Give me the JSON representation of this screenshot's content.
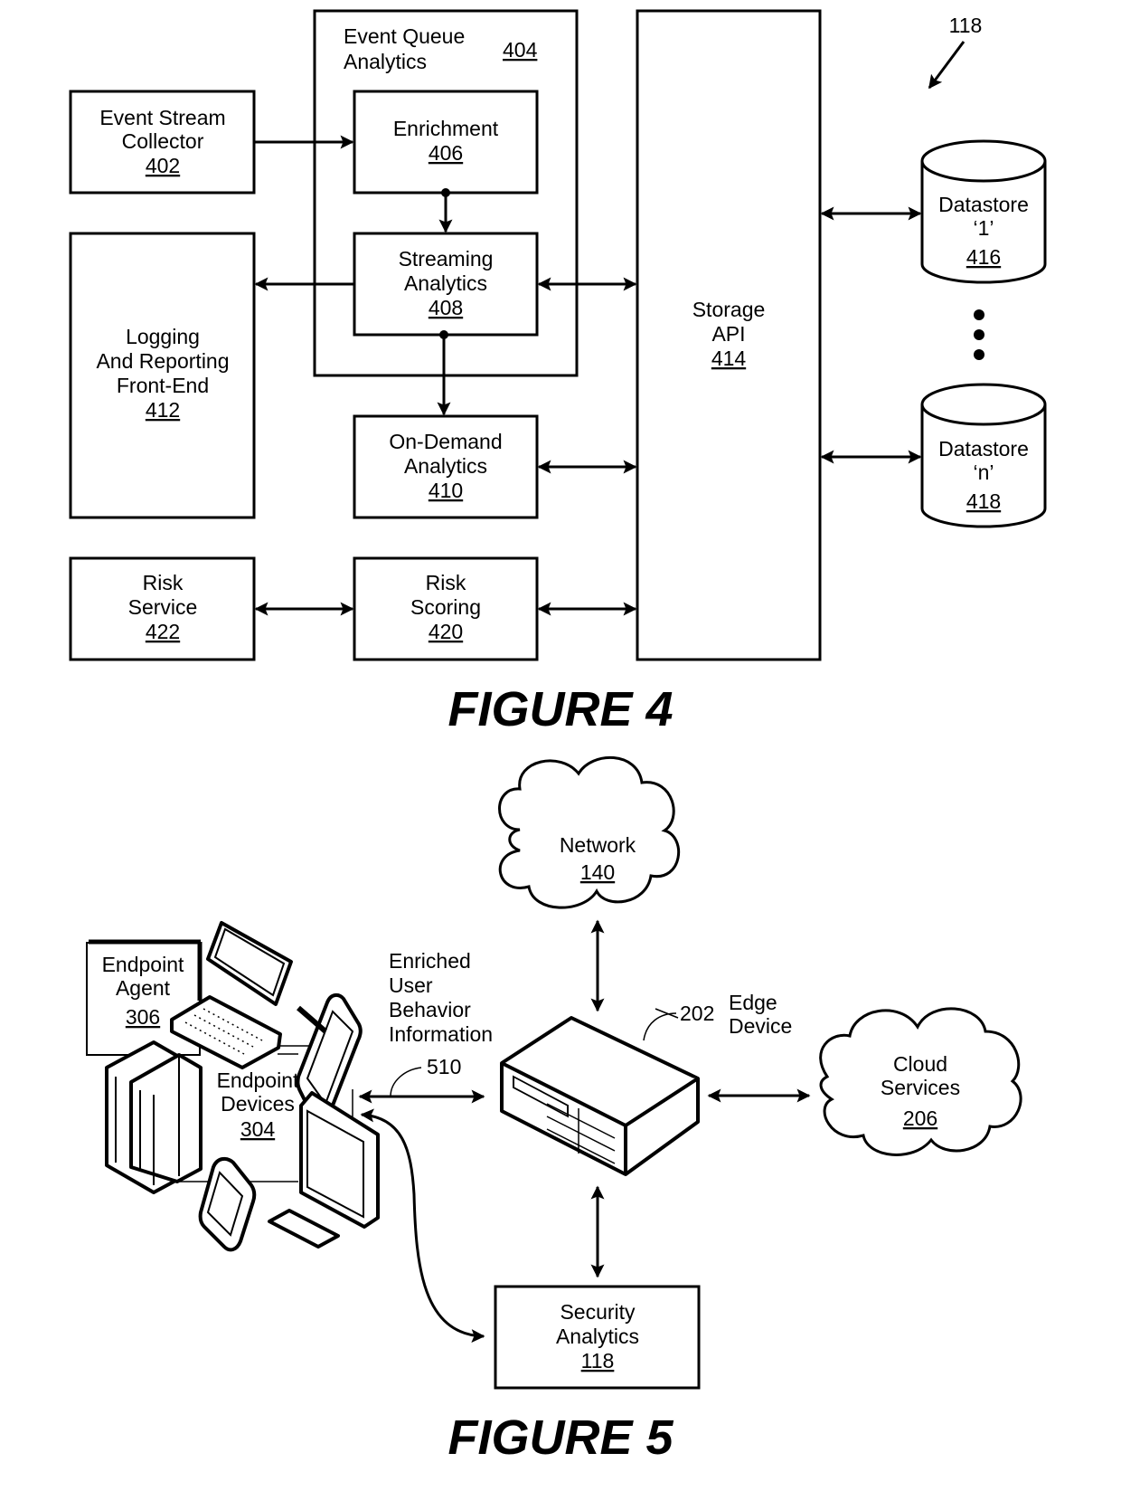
{
  "figure4": {
    "caption": "FIGURE 4",
    "reference_label": "118",
    "nodes": {
      "event_stream_collector": {
        "lines": [
          "Event Stream",
          "Collector"
        ],
        "ref": "402"
      },
      "event_queue_analytics": {
        "lines": [
          "Event Queue",
          "Analytics"
        ],
        "ref": "404"
      },
      "enrichment": {
        "lines": [
          "Enrichment"
        ],
        "ref": "406"
      },
      "streaming_analytics": {
        "lines": [
          "Streaming",
          "Analytics"
        ],
        "ref": "408"
      },
      "on_demand_analytics": {
        "lines": [
          "On-Demand",
          "Analytics"
        ],
        "ref": "410"
      },
      "logging_reporting": {
        "lines": [
          "Logging",
          "And Reporting",
          "Front-End"
        ],
        "ref": "412"
      },
      "storage_api": {
        "lines": [
          "Storage",
          "API"
        ],
        "ref": "414"
      },
      "datastore_1": {
        "lines": [
          "Datastore",
          "‘1’"
        ],
        "ref": "416"
      },
      "datastore_n": {
        "lines": [
          "Datastore",
          "‘n’"
        ],
        "ref": "418"
      },
      "risk_scoring": {
        "lines": [
          "Risk",
          "Scoring"
        ],
        "ref": "420"
      },
      "risk_service": {
        "lines": [
          "Risk",
          "Service"
        ],
        "ref": "422"
      }
    },
    "edges": [
      {
        "from": "event_stream_collector",
        "to": "enrichment",
        "type": "arrow"
      },
      {
        "from": "enrichment",
        "to": "streaming_analytics",
        "type": "arrow"
      },
      {
        "from": "streaming_analytics",
        "to": "logging_reporting",
        "type": "arrow"
      },
      {
        "from": "streaming_analytics",
        "to": "on_demand_analytics",
        "type": "arrow"
      },
      {
        "from": "streaming_analytics",
        "to": "storage_api",
        "type": "bidirectional"
      },
      {
        "from": "on_demand_analytics",
        "to": "storage_api",
        "type": "bidirectional"
      },
      {
        "from": "risk_scoring",
        "to": "storage_api",
        "type": "bidirectional"
      },
      {
        "from": "risk_service",
        "to": "risk_scoring",
        "type": "bidirectional"
      },
      {
        "from": "storage_api",
        "to": "datastore_1",
        "type": "bidirectional"
      },
      {
        "from": "storage_api",
        "to": "datastore_n",
        "type": "bidirectional"
      }
    ]
  },
  "figure5": {
    "caption": "FIGURE 5",
    "nodes": {
      "network": {
        "lines": [
          "Network"
        ],
        "ref": "140"
      },
      "edge_device": {
        "lines": [
          "Edge",
          "Device"
        ],
        "ref": "202"
      },
      "cloud_services": {
        "lines": [
          "Cloud",
          "Services"
        ],
        "ref": "206"
      },
      "endpoint_devices": {
        "lines": [
          "Endpoint",
          "Devices"
        ],
        "ref": "304"
      },
      "endpoint_agent": {
        "lines": [
          "Endpoint",
          "Agent"
        ],
        "ref": "306"
      },
      "security_analytics": {
        "lines": [
          "Security",
          "Analytics"
        ],
        "ref": "118"
      },
      "enriched_info": {
        "lines": [
          "Enriched",
          "User",
          "Behavior",
          "Information"
        ],
        "ref": "510"
      }
    },
    "edges": [
      {
        "from": "network",
        "to": "edge_device",
        "type": "bidirectional"
      },
      {
        "from": "endpoint_devices",
        "to": "edge_device",
        "type": "bidirectional",
        "label": "510"
      },
      {
        "from": "edge_device",
        "to": "cloud_services",
        "type": "bidirectional"
      },
      {
        "from": "edge_device",
        "to": "security_analytics",
        "type": "bidirectional"
      },
      {
        "from": "endpoint_devices",
        "to": "security_analytics",
        "type": "bidirectional"
      }
    ]
  }
}
